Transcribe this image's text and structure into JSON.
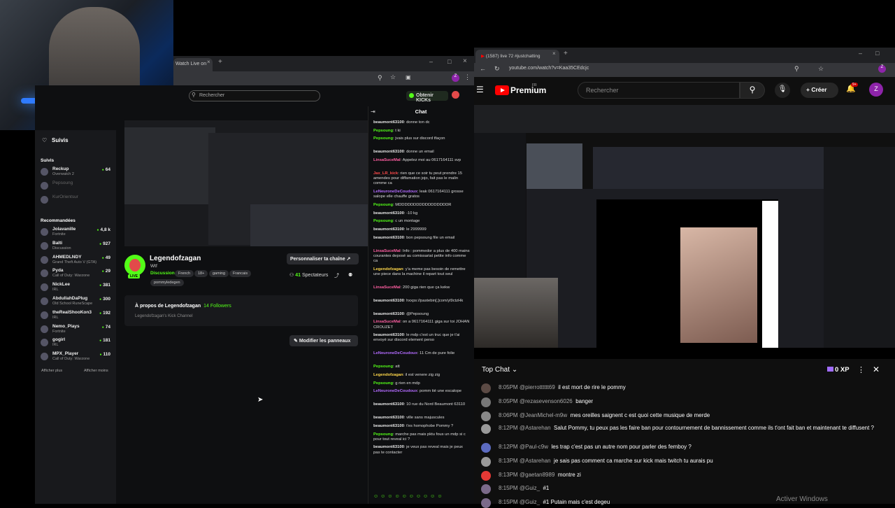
{
  "kick": {
    "tab_label": "Watch Live on",
    "search_placeholder": "Rechercher",
    "obtain_label": "Obtenir KICKs",
    "sidebar": {
      "heading": "Suivis",
      "followed_title": "Suivis",
      "followed": [
        {
          "name": "Reckup",
          "game": "Overwatch 2",
          "viewers": "64",
          "online": true
        },
        {
          "name": "Pepsoung",
          "game": "",
          "viewers": "",
          "online": false
        },
        {
          "name": "KurOrientsur",
          "game": "",
          "viewers": "",
          "online": false
        }
      ],
      "recommended_title": "Recommandées",
      "recommended": [
        {
          "name": "Jolavanille",
          "game": "Fortnite",
          "viewers": "4,8 k"
        },
        {
          "name": "Balti",
          "game": "Discussion",
          "viewers": "927"
        },
        {
          "name": "AHMEDLNDY",
          "game": "Grand Theft Auto V (GTA)",
          "viewers": "49"
        },
        {
          "name": "Pyda",
          "game": "Call of Duty: Warzone",
          "viewers": "29"
        },
        {
          "name": "NickLee",
          "game": "IRL",
          "viewers": "381"
        },
        {
          "name": "AbdullahDaPlug",
          "game": "Old School RuneScape",
          "viewers": "300"
        },
        {
          "name": "theRealShooKon3",
          "game": "IRL",
          "viewers": "192"
        },
        {
          "name": "Nemo_Plays",
          "game": "Fortnite",
          "viewers": "74"
        },
        {
          "name": "gogirl",
          "game": "IRL",
          "viewers": "181"
        },
        {
          "name": "MPX_Player",
          "game": "Call of Duty: Warzone",
          "viewers": "110"
        }
      ],
      "show_more": "Afficher plus",
      "show_less": "Afficher moins"
    },
    "channel": {
      "live": "LIVE",
      "name": "Legendofzagan",
      "title": "Wtf",
      "category": "Discussion",
      "tags": [
        "French",
        "18+",
        "gaming",
        "Francais",
        "pommyledegen"
      ],
      "customize_label": "Personnaliser ta chaîne",
      "viewers": "41",
      "viewers_label": "Spectateurs",
      "about_title": "À propos de Legendofzagan",
      "followers": "14 Followers",
      "about_sub": "Legendofzagan's Kick Channel",
      "edit_panels_label": "Modifier les panneaux"
    },
    "chat": {
      "title": "Chat",
      "messages": [
        {
          "user": "beaumont63100",
          "color": "#e6e6e6",
          "text": "donne ton dc"
        },
        {
          "user": "Pepsoung",
          "color": "#53fc18",
          "text": "t ki"
        },
        {
          "user": "Pepsoung",
          "color": "#53fc18",
          "text": "jvais plus sur discord tfaçon"
        },
        {
          "user": "beaumont63100",
          "color": "#e6e6e6",
          "text": "donne un email"
        },
        {
          "user": "LinsaSuceMal",
          "color": "#ff5fa2",
          "text": "Appelez moi au 0617164111 svp"
        },
        {
          "user": "Jax_LR_kick",
          "color": "#ff4b4b",
          "text": "rien que ce soir tu peut prendre 15 amendes pour diffamation jojo, fait pas le malin comme ca"
        },
        {
          "user": "LeNeuroneDeCoudoux",
          "color": "#b36bff",
          "text": "leak 0617164111 grosse salope elle chauffe gratos"
        },
        {
          "user": "Pepsoung",
          "color": "#53fc18",
          "text": "MDDDDDDDDDDDDDDDDDR"
        },
        {
          "user": "beaumont63100",
          "color": "#e6e6e6",
          "text": "-10 kg"
        },
        {
          "user": "Pepsoung",
          "color": "#53fc18",
          "text": "c un montage"
        },
        {
          "user": "beaumont63100",
          "color": "#e6e6e6",
          "text": "le 2999999"
        },
        {
          "user": "beaumont63100",
          "color": "#e6e6e6",
          "text": "bon pepsoung file un email"
        },
        {
          "user": "LinsaSuceMal",
          "color": "#ff5fa2",
          "text": "Info : pommedor a plus de 400 mains courantes deposé au comissariat petite info comme ca"
        },
        {
          "user": "Legendofzagan",
          "color": "#ffd84b",
          "text": "y'a meme pas besoin de remettre une piece dans la machine il repart tout seul"
        },
        {
          "user": "LinsaSuceMal",
          "color": "#ff5fa2",
          "text": "200 giga rien que ça kekw"
        },
        {
          "user": "beaumont63100",
          "color": "#e6e6e6",
          "text": "hxxps://pastebin[.]com/yl9ctzHk"
        },
        {
          "user": "beaumont63100",
          "color": "#e6e6e6",
          "text": "@Pepsoung"
        },
        {
          "user": "LinsaSuceMal",
          "color": "#ff5fa2",
          "text": "on a 0617164111 giga sur toi JOHAN CROUZET"
        },
        {
          "user": "beaumont63100",
          "color": "#e6e6e6",
          "text": "le mdp c'est un truc que je t'ai envoyé sur discord element perso"
        },
        {
          "user": "LeNeuroneDeCoudoux",
          "color": "#b36bff",
          "text": "11 Cm de pure folie"
        },
        {
          "user": "Pepsoung",
          "color": "#53fc18",
          "text": "att"
        },
        {
          "user": "Legendofzagan",
          "color": "#ffd84b",
          "text": "il est venere zig zig"
        },
        {
          "user": "Pepsoung",
          "color": "#53fc18",
          "text": "g rien en mdp"
        },
        {
          "user": "LeNeuroneDeCoudoux",
          "color": "#b36bff",
          "text": "pomm tié une escalope"
        },
        {
          "user": "beaumont63100",
          "color": "#e6e6e6",
          "text": "10 rue du Nord Beaumont 63110"
        },
        {
          "user": "beaumont63100",
          "color": "#e6e6e6",
          "text": "ville sans majuscules"
        },
        {
          "user": "beaumont63100",
          "color": "#e6e6e6",
          "text": "t'es homophobe Pommy ?"
        },
        {
          "user": "Pepsoung",
          "color": "#53fc18",
          "text": "marche pas mais pktu fous un mdp si c pour tout reveal ici ?"
        },
        {
          "user": "beaumont63100",
          "color": "#e6e6e6",
          "text": "je veux pas reveal mais je peux pas te contacter"
        }
      ]
    }
  },
  "youtube": {
    "tab_label": "(1587) live 72 #justchatting",
    "url": "youtube.com/watch?v=Kaa35CEdcjc",
    "brand": "Premium",
    "brand_sup": "FR",
    "search_placeholder": "Rechercher",
    "create_label": "Créer",
    "notif_count": "9+",
    "avatar_letter": "Z",
    "chat": {
      "title": "Top Chat",
      "xp": "0 XP",
      "messages": [
        {
          "time": "8:05PM",
          "user": "@pierrotttttt69",
          "text": "il est mort de rire le pommy",
          "av": "#5b4a44"
        },
        {
          "time": "8:05PM",
          "user": "@rezasevenson6026",
          "text": "banger",
          "av": "#777"
        },
        {
          "time": "8:06PM",
          "user": "@JeanMichel-m9w",
          "text": "mes oreilles saignent c est quoi cette musique de merde",
          "av": "#888"
        },
        {
          "time": "8:12PM",
          "user": "@Astarehan",
          "text": "Salut Pommy, tu peux pas les faire ban pour contournement de bannissement comme ils t'ont fait ban et maintenant te diffusent ?",
          "av": "#999"
        },
        {
          "time": "8:12PM",
          "user": "@Paul-c9w",
          "text": "les trap c'est pas un autre nom pour parler des femboy ?",
          "av": "#5c6bc0"
        },
        {
          "time": "8:13PM",
          "user": "@Astarehan",
          "text": "je sais pas comment ca marche sur kick mais twitch tu aurais pu",
          "av": "#999"
        },
        {
          "time": "8:13PM",
          "user": "@gaetan8989",
          "text": "montre zi",
          "av": "#e53935"
        },
        {
          "time": "8:15PM",
          "user": "@Guiz_",
          "text": "#1",
          "av": "#7b6a8a"
        },
        {
          "time": "8:15PM",
          "user": "@Guiz_",
          "text": "#1  Putain mais c'est degeu",
          "av": "#7b6a8a"
        }
      ]
    }
  },
  "system": {
    "activate_windows": "Activer Windows"
  }
}
